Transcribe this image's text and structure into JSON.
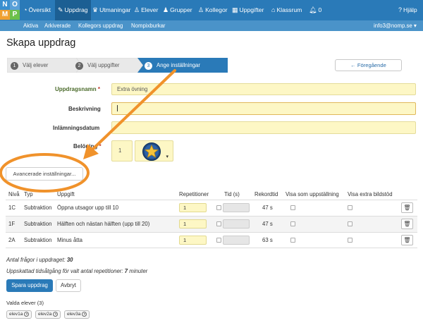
{
  "logo": {
    "letters": [
      "N",
      "O",
      "M",
      "P"
    ],
    "colors": [
      "#3a8fd0",
      "#2a7ab8",
      "#f0a030",
      "#f0c040"
    ]
  },
  "nav": {
    "items": [
      {
        "label": "Översikt",
        "icon": "dashboard-icon"
      },
      {
        "label": "Uppdrag",
        "icon": "edit-icon",
        "active": true
      },
      {
        "label": "Utmaningar",
        "icon": "trophy-icon"
      },
      {
        "label": "Elever",
        "icon": "user-icon"
      },
      {
        "label": "Grupper",
        "icon": "group-icon"
      },
      {
        "label": "Kollegor",
        "icon": "colleagues-icon"
      },
      {
        "label": "Uppgifter",
        "icon": "table-icon"
      },
      {
        "label": "Klassrum",
        "icon": "classroom-icon"
      },
      {
        "label": "0",
        "icon": "bell-icon"
      }
    ],
    "help": "Hjälp"
  },
  "subnav": {
    "items": [
      "Aktiva",
      "Arkiverade",
      "Kollegors uppdrag",
      "Nompixburkar"
    ],
    "user": "info3@nomp.se"
  },
  "page_title": "Skapa uppdrag",
  "steps": [
    {
      "num": "1",
      "label": "Välj elever"
    },
    {
      "num": "2",
      "label": "Välj uppgifter"
    },
    {
      "num": "3",
      "label": "Ange inställningar",
      "active": true
    }
  ],
  "prev_button": "← Föregående",
  "form": {
    "name_label": "Uppdragsnamn",
    "name_value": "Extra övning",
    "desc_label": "Beskrivning",
    "date_label": "Inlämningsdatum",
    "reward_label": "Belöning",
    "reward_value": "1"
  },
  "advanced_button": "Avancerade inställningar...",
  "table": {
    "headers": [
      "Nivå",
      "Typ",
      "Uppgift",
      "Repetitioner",
      "Tid (s)",
      "Rekordtid",
      "Visa som uppställning",
      "Visa extra bildstöd"
    ],
    "rows": [
      {
        "level": "1C",
        "type": "Subtraktion",
        "task": "Öppna utsagor upp till 10",
        "reps": "1",
        "record": "47 s"
      },
      {
        "level": "1F",
        "type": "Subtraktion",
        "task": "Hälften och nästan hälften (upp till 20)",
        "reps": "1",
        "record": "47 s"
      },
      {
        "level": "2A",
        "type": "Subtraktion",
        "task": "Minus åtta",
        "reps": "1",
        "record": "63 s"
      }
    ]
  },
  "summary": {
    "questions_label": "Antal frågor i uppdraget:",
    "questions_value": "30",
    "time_label": "Uppskattad tidsåtgång för valt antal repetitioner:",
    "time_value": "7",
    "time_unit": "minuter"
  },
  "save_button": "Spara uppdrag",
  "cancel_button": "Avbryt",
  "chosen_students_label": "Valda elever (3)",
  "students": [
    "elev1a",
    "elev2a",
    "elev3a"
  ],
  "colors": {
    "accent": "#2a7ab8",
    "annotation": "#f0922b",
    "input_bg": "#fdf7c5"
  }
}
